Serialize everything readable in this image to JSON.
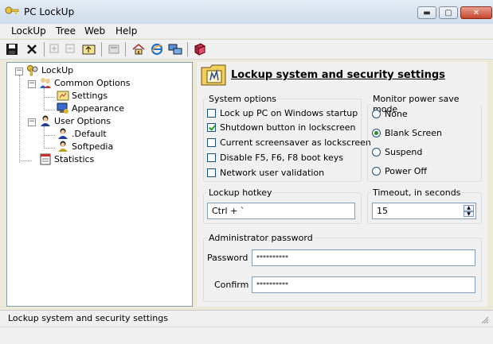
{
  "window": {
    "title": "PC LockUp",
    "minimize": "▬",
    "maximize": "▢",
    "close": "✕"
  },
  "menu": [
    "LockUp",
    "Tree",
    "Web",
    "Help"
  ],
  "tree": {
    "root": "LockUp",
    "common": "Common Options",
    "settings": "Settings",
    "appearance": "Appearance",
    "user": "User Options",
    "default": ".Default",
    "softpedia": "Softpedia",
    "statistics": "Statistics"
  },
  "panel": {
    "title": "Lockup system and security settings",
    "system_options": {
      "legend": "System options",
      "items": [
        {
          "label": "Lock up PC on Windows startup",
          "checked": false
        },
        {
          "label": "Shutdown button in lockscreen",
          "checked": true
        },
        {
          "label": "Current screensaver as lockscreen",
          "checked": false
        },
        {
          "label": "Disable F5, F6, F8 boot keys",
          "checked": false
        },
        {
          "label": "Network user validation",
          "checked": false
        }
      ]
    },
    "monitor": {
      "legend": "Monitor power save mode",
      "options": [
        "None",
        "Blank Screen",
        "Suspend",
        "Power Off"
      ],
      "selected": "Blank Screen"
    },
    "hotkey": {
      "legend": "Lockup hotkey",
      "value": "Ctrl + `"
    },
    "timeout": {
      "legend": "Timeout, in seconds",
      "value": "15"
    },
    "admin": {
      "legend": "Administrator password",
      "password_label": "Password :",
      "password_value": "**********",
      "confirm_label": "Confirm :",
      "confirm_value": "**********"
    }
  },
  "status": {
    "text": "Lockup system and security settings"
  },
  "colors": {
    "accent": "#1c5180",
    "check": "#21a121"
  }
}
